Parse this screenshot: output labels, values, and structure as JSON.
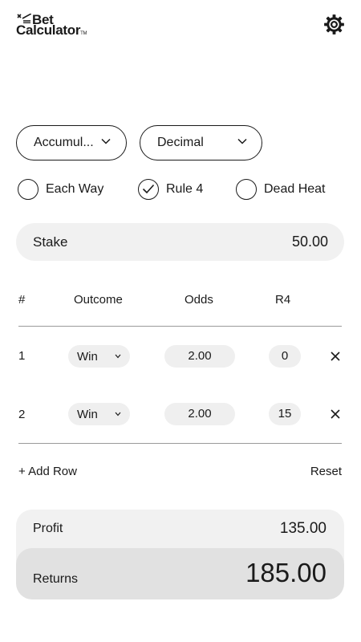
{
  "header": {
    "logo_line1": "Bet",
    "logo_line2": "Calculator",
    "logo_tm": "TM",
    "settings_icon": "gear-icon"
  },
  "controls": {
    "bet_type": "Accumul...",
    "odds_format": "Decimal",
    "options": [
      {
        "label": "Each Way",
        "checked": false
      },
      {
        "label": "Rule 4",
        "checked": true
      },
      {
        "label": "Dead Heat",
        "checked": false
      }
    ]
  },
  "stake": {
    "label": "Stake",
    "value": "50.00"
  },
  "table": {
    "headers": [
      "#",
      "Outcome",
      "Odds",
      "R4"
    ],
    "rows": [
      {
        "num": "1",
        "outcome": "Win",
        "odds": "2.00",
        "r4": "0"
      },
      {
        "num": "2",
        "outcome": "Win",
        "odds": "2.00",
        "r4": "15"
      }
    ]
  },
  "actions": {
    "add_row": "+ Add Row",
    "reset": "Reset"
  },
  "results": {
    "profit_label": "Profit",
    "profit_value": "135.00",
    "returns_label": "Returns",
    "returns_value": "185.00"
  },
  "colors": {
    "text": "#1a1a1a",
    "panel": "#f1f1f1",
    "returns_panel": "#e1e1e1",
    "pill": "#efefef"
  }
}
